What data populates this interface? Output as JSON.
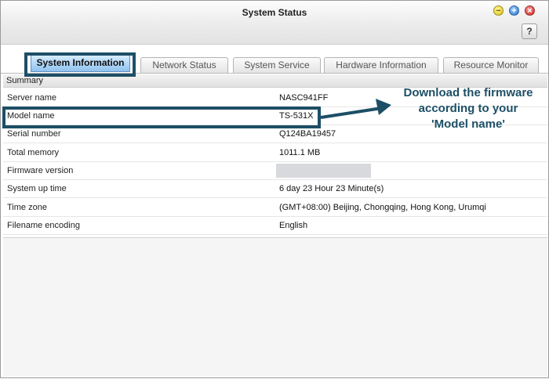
{
  "window": {
    "title": "System Status",
    "help_label": "?"
  },
  "tabs": [
    {
      "label": "System Information",
      "active": true
    },
    {
      "label": "Network Status",
      "active": false
    },
    {
      "label": "System Service",
      "active": false
    },
    {
      "label": "Hardware Information",
      "active": false
    },
    {
      "label": "Resource Monitor",
      "active": false
    }
  ],
  "summary": {
    "header": "Summary",
    "rows": [
      {
        "key": "Server name",
        "value": "NASC941FF"
      },
      {
        "key": "Model name",
        "value": "TS-531X"
      },
      {
        "key": "Serial number",
        "value": "Q124BA19457"
      },
      {
        "key": "Total memory",
        "value": "1011.1 MB"
      },
      {
        "key": "Firmware version",
        "value": ""
      },
      {
        "key": "System up time",
        "value": "6 day 23 Hour 23 Minute(s)"
      },
      {
        "key": "Time zone",
        "value": "(GMT+08:00) Beijing, Chongqing, Hong Kong, Urumqi"
      },
      {
        "key": "Filename encoding",
        "value": "English"
      }
    ]
  },
  "annotation": {
    "line1": "Download the firmware",
    "line2": "according to your",
    "line3": "'Model name'",
    "color": "#1d4f66"
  },
  "colors": {
    "highlight": "#1d4f66",
    "active_tab": "#8fc3ef"
  },
  "icons": {
    "minimize": "minimize-icon",
    "maximize": "maximize-icon",
    "close": "close-icon"
  }
}
